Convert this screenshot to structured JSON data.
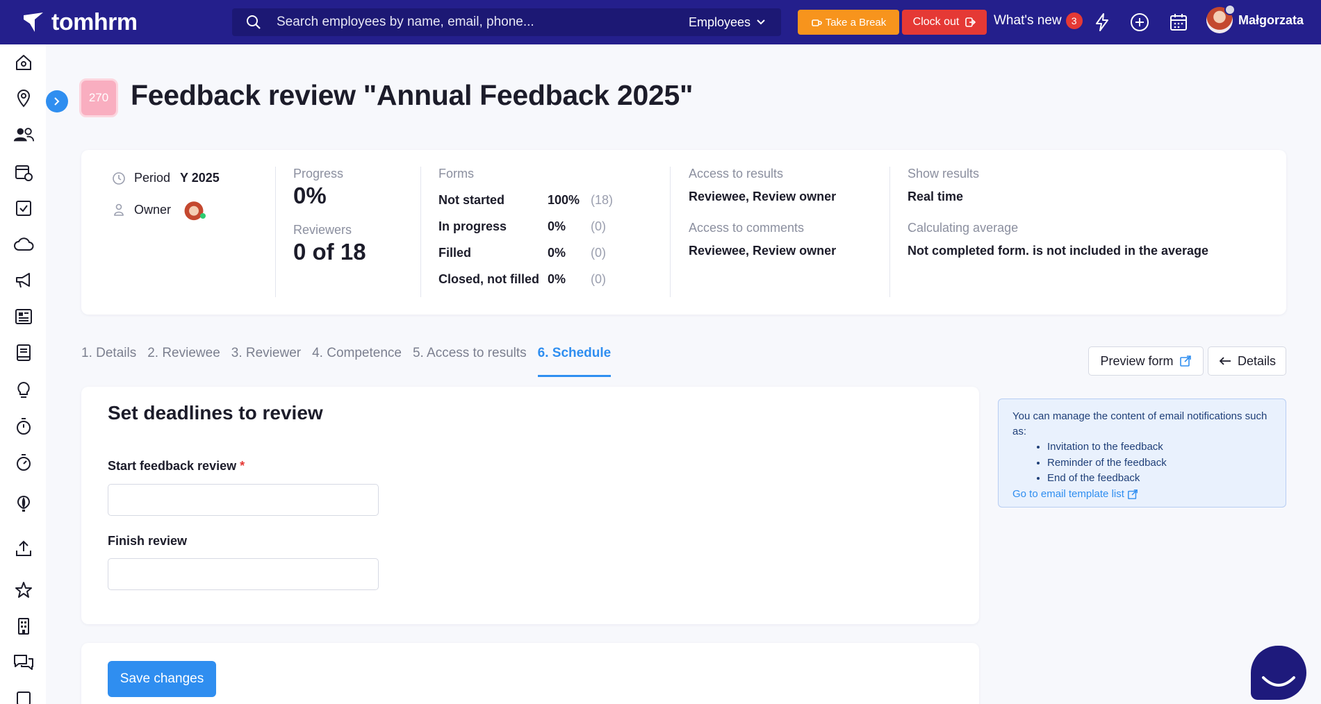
{
  "topbar": {
    "brand": "tomhrm",
    "search_placeholder": "Search employees by name, email, phone...",
    "search_scope": "Employees",
    "take_break": "Take a Break",
    "clock_out": "Clock out",
    "whats_new": "What's new",
    "whats_new_count": "3",
    "user_name": "Małgorzata",
    "brand_color": "#241f8c"
  },
  "header": {
    "badge": "270",
    "title": "Feedback review \"Annual Feedback 2025\""
  },
  "summary": {
    "period_label": "Period",
    "period_value": "Y 2025",
    "owner_label": "Owner",
    "progress_label": "Progress",
    "progress_value": "0%",
    "reviewers_label": "Reviewers",
    "reviewers_value": "0 of 18",
    "forms_label": "Forms",
    "forms": [
      {
        "label": "Not started",
        "pct": "100%",
        "count": "(18)"
      },
      {
        "label": "In progress",
        "pct": "0%",
        "count": "(0)"
      },
      {
        "label": "Filled",
        "pct": "0%",
        "count": "(0)"
      },
      {
        "label": "Closed, not filled",
        "pct": "0%",
        "count": "(0)"
      }
    ],
    "access_results_label": "Access to results",
    "access_results_value": "Reviewee, Review owner",
    "access_comments_label": "Access to comments",
    "access_comments_value": "Reviewee, Review owner",
    "show_results_label": "Show results",
    "show_results_value": "Real time",
    "calc_avg_label": "Calculating average",
    "calc_avg_value": "Not completed form. is not included in the average"
  },
  "tabs": [
    {
      "label": "1. Details",
      "active": false
    },
    {
      "label": "2. Reviewee",
      "active": false
    },
    {
      "label": "3. Reviewer",
      "active": false
    },
    {
      "label": "4. Competence",
      "active": false
    },
    {
      "label": "5. Access to results",
      "active": false
    },
    {
      "label": "6. Schedule",
      "active": true
    }
  ],
  "actions": {
    "preview_form": "Preview form",
    "details": "Details"
  },
  "deadlines": {
    "title": "Set deadlines to review",
    "start_label": "Start feedback review",
    "required_mark": "*",
    "start_value": "",
    "finish_label": "Finish review",
    "finish_value": ""
  },
  "info": {
    "intro": "You can manage the content of email notifications such as:",
    "items": [
      "Invitation to the feedback",
      "Reminder of the feedback",
      "End of the feedback"
    ],
    "link": "Go to email template list"
  },
  "save_button": "Save changes"
}
